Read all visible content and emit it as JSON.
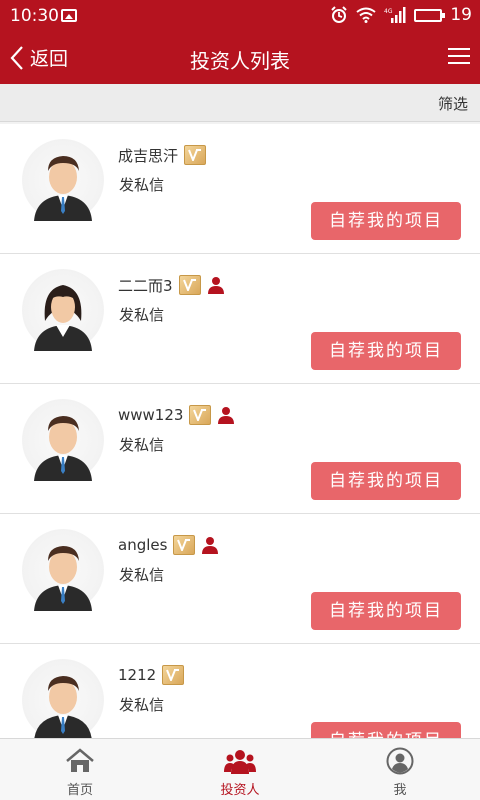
{
  "statusbar": {
    "time": "10:30",
    "network": "4G",
    "battery": "19"
  },
  "navbar": {
    "back_label": "返回",
    "title": "投资人列表"
  },
  "filter": {
    "label": "筛选"
  },
  "investors": [
    {
      "name": "成吉思汗",
      "gender": "male",
      "dm_label": "发私信",
      "button_label": "自荐我的项目",
      "has_user_icon": false
    },
    {
      "name": "二二而3",
      "gender": "female",
      "dm_label": "发私信",
      "button_label": "自荐我的项目",
      "has_user_icon": true
    },
    {
      "name": "www123",
      "gender": "male",
      "dm_label": "发私信",
      "button_label": "自荐我的项目",
      "has_user_icon": true
    },
    {
      "name": "angles",
      "gender": "male",
      "dm_label": "发私信",
      "button_label": "自荐我的项目",
      "has_user_icon": true
    },
    {
      "name": "1212",
      "gender": "male",
      "dm_label": "发私信",
      "button_label": "自荐我的项目",
      "has_user_icon": false
    }
  ],
  "tabs": [
    {
      "label": "首页",
      "icon": "home-icon",
      "active": false
    },
    {
      "label": "投资人",
      "icon": "investors-icon",
      "active": true
    },
    {
      "label": "我",
      "icon": "profile-icon",
      "active": false
    }
  ],
  "colors": {
    "primary": "#b5131f",
    "button": "#e8666a",
    "badge_gold": "#d9a75a"
  }
}
